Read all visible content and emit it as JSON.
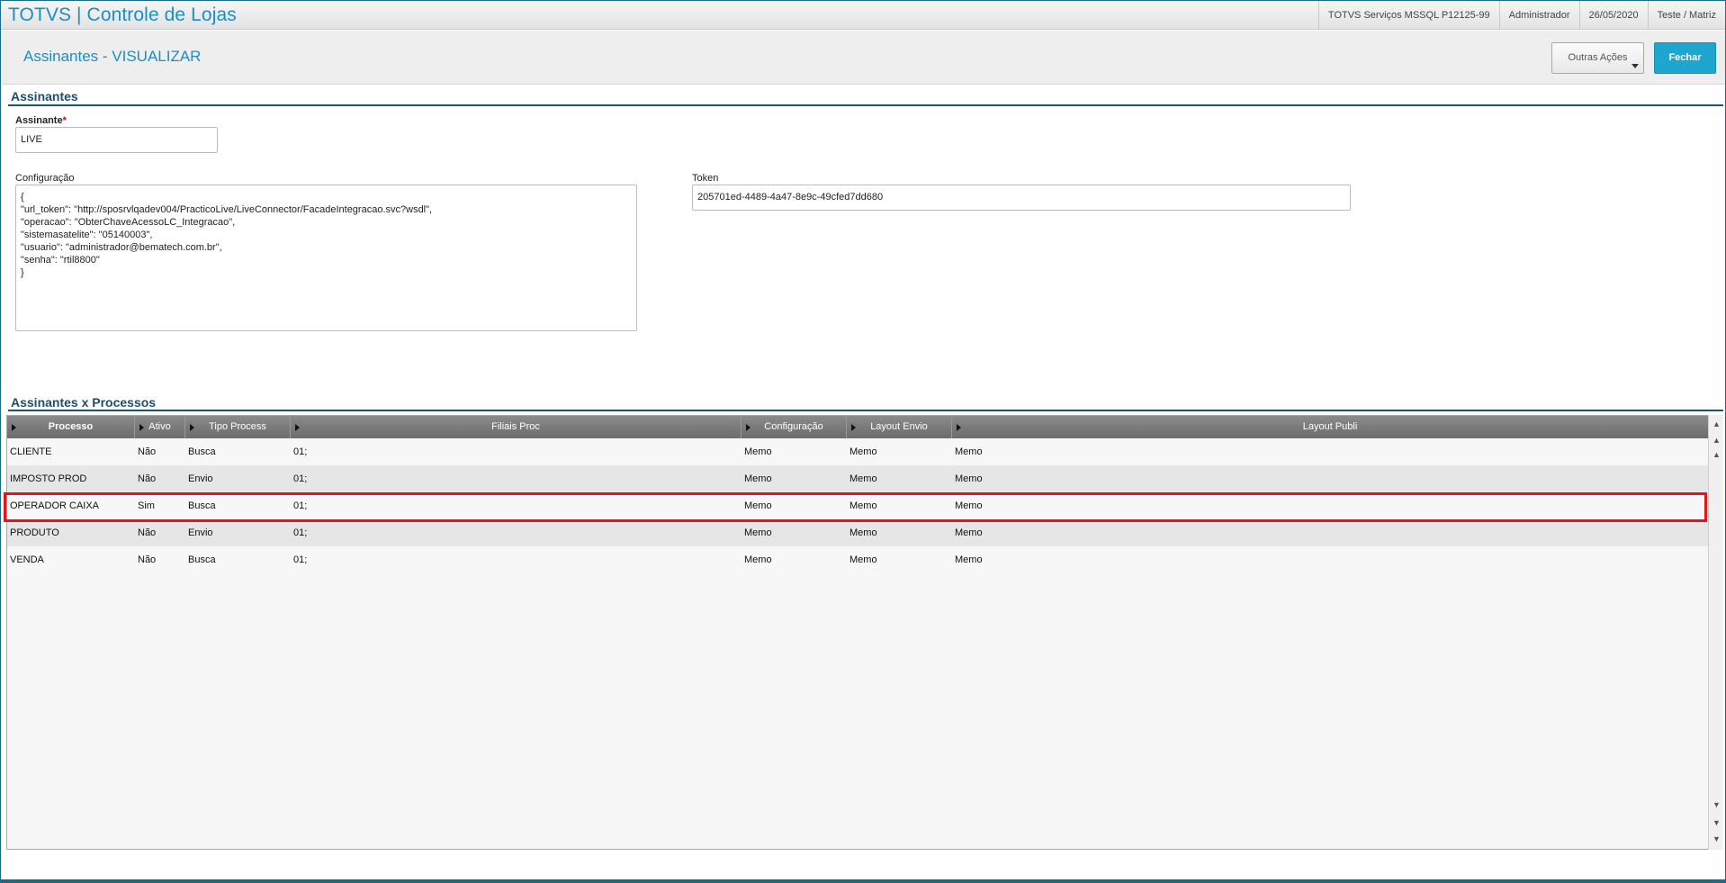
{
  "app": {
    "title": "TOTVS | Controle de Lojas",
    "environment": "TOTVS Serviços MSSQL P12125-99",
    "user": "Administrador",
    "date": "26/05/2020",
    "branch": "Teste / Matriz"
  },
  "header": {
    "title": "Assinantes - VISUALIZAR",
    "outras_acoes_label": "Outras Ações",
    "fechar_label": "Fechar"
  },
  "assinantes_section": {
    "title": "Assinantes",
    "assinante_label": "Assinante",
    "assinante_required": "*",
    "assinante_value": "LIVE",
    "configuracao_label": "Configuração",
    "configuracao_value": "{\n\"url_token\": \"http://sposrvlqadev004/PracticoLive/LiveConnector/FacadeIntegracao.svc?wsdl\",\n\"operacao\": \"ObterChaveAcessoLC_Integracao\",\n\"sistemasatelite\": \"05140003\",\n\"usuario\": \"administrador@bematech.com.br\",\n\"senha\": \"rtil8800\"\n}",
    "token_label": "Token",
    "token_value": "205701ed-4489-4a47-8e9c-49cfed7dd680"
  },
  "processos_section": {
    "title": "Assinantes x Processos",
    "columns": [
      "Processo",
      "Ativo",
      "Tipo Process",
      "Filiais Proc",
      "Configuração",
      "Layout Envio",
      "Layout Publi"
    ],
    "rows": [
      [
        "CLIENTE",
        "Não",
        "Busca",
        "01;",
        "Memo",
        "Memo",
        "Memo"
      ],
      [
        "IMPOSTO PROD",
        "Não",
        "Envio",
        "01;",
        "Memo",
        "Memo",
        "Memo"
      ],
      [
        "OPERADOR CAIXA",
        "Sim",
        "Busca",
        "01;",
        "Memo",
        "Memo",
        "Memo"
      ],
      [
        "PRODUTO",
        "Não",
        "Envio",
        "01;",
        "Memo",
        "Memo",
        "Memo"
      ],
      [
        "VENDA",
        "Não",
        "Busca",
        "01;",
        "Memo",
        "Memo",
        "Memo"
      ]
    ],
    "highlighted_row": "OPERADOR CAIXA"
  },
  "colors": {
    "accent": "#1a8fc4",
    "button_primary": "#1ea6cf",
    "highlight_border": "#e0161b",
    "section_title": "#1a4f6e"
  }
}
